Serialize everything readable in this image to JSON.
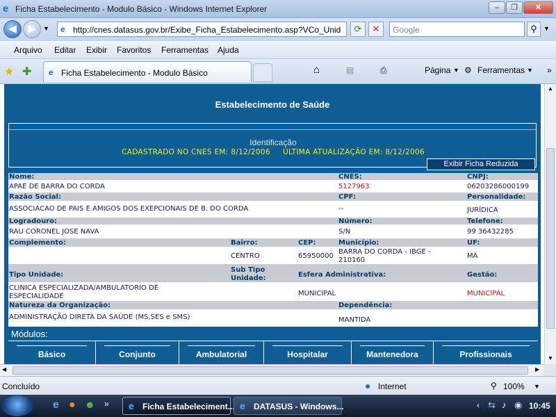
{
  "window": {
    "title": "Ficha Estabelecimento - Modulo Básico - Windows Internet Explorer"
  },
  "nav": {
    "address": "http://cnes.datasus.gov.br/Exibe_Ficha_Estabelecimento.asp?VCo_Unid",
    "search_placeholder": "Google"
  },
  "menu": [
    "Arquivo",
    "Editar",
    "Exibir",
    "Favoritos",
    "Ferramentas",
    "Ajuda"
  ],
  "tabs": {
    "active": "Ficha Estabelecimento - Modulo Básico"
  },
  "toolbar": {
    "pagina": "Página",
    "ferramentas": "Ferramentas"
  },
  "page": {
    "heading": "Estabelecimento de Saúde",
    "id_title": "Identificação",
    "id_sub": "CADASTRADO NO CNES EM: 8/12/2006     ÚLTIMA ATUALIZAÇÃO EM: 8/12/2006",
    "reduced_button": "Exibir Ficha Reduzida",
    "labels": {
      "nome": "Nome:",
      "cnes": "CNES:",
      "cnpj": "CNPJ:",
      "razao": "Razão Social:",
      "cpf": "CPF:",
      "personalidade": "Personalidade:",
      "logradouro": "Logradouro:",
      "numero": "Número:",
      "telefone": "Telefone:",
      "complemento": "Complemento:",
      "bairro": "Bairro:",
      "cep": "CEP:",
      "municipio": "Município:",
      "uf": "UF:",
      "tipo": "Tipo Unidade:",
      "subtipo1": "Sub Tipo",
      "subtipo2": "Unidade:",
      "esfera": "Esfera Administrativa:",
      "gestao": "Gestão:",
      "natureza": "Natureza da Organização:",
      "dependencia": "Dependência:"
    },
    "values": {
      "nome": "APAE DE BARRA DO CORDA",
      "cnes": "5127963",
      "cnpj": "06203286000199",
      "razao": "ASSOCIACAO DE PAIS E AMIGOS DOS EXEPCIONAIS DE B. DO CORDA",
      "cpf": "--",
      "personalidade": "JURÍDICA",
      "logradouro": "RAU CORONEL JOSE NAVA",
      "numero": "S/N",
      "telefone": "99 36432285",
      "bairro": "CENTRO",
      "cep": "65950000",
      "municipio1": "BARRA DO CORDA - IBGE -",
      "municipio2": "210160",
      "uf": "MA",
      "tipo1": "CLINICA ESPECIALIZADA/AMBULATORIO DE",
      "tipo2": "ESPECIALIDADE",
      "esfera": "MUNICIPAL",
      "gestao": "MUNICIPAL",
      "natureza": "ADMINISTRAÇÃO DIRETA DA SAÚDE (MS,SES e SMS)",
      "dependencia": "MANTIDA"
    },
    "modulos_label": "Módulos:",
    "modules": [
      "Básico",
      "Conjunto",
      "Ambulatorial",
      "Hospitalar",
      "Mantenedora",
      "Profissionais"
    ]
  },
  "status": {
    "text": "Concluído",
    "zone": "Internet",
    "zoom": "100%"
  },
  "taskbar": {
    "task1": "Ficha Estabeleciment...",
    "task2": "DATASUS - Windows...",
    "clock": "10:45"
  }
}
